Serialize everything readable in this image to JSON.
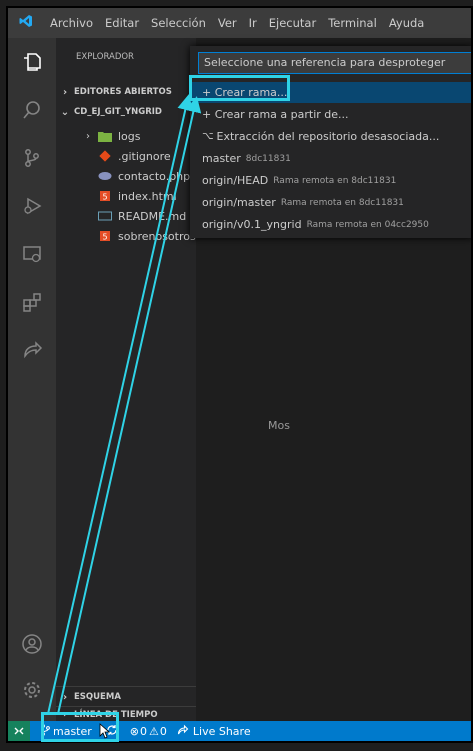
{
  "titlebar": {
    "menus": [
      "Archivo",
      "Editar",
      "Selección",
      "Ver",
      "Ir",
      "Ejecutar",
      "Terminal",
      "Ayuda"
    ]
  },
  "sidebar": {
    "title": "EXPLORADOR",
    "open_editors": "EDITORES ABIERTOS",
    "project": "CD_EJ_GIT_YNGRID",
    "files": [
      {
        "name": "logs",
        "icon": "folder-icon"
      },
      {
        "name": ".gitignore",
        "icon": "git-file-icon"
      },
      {
        "name": "contacto.php",
        "icon": "php-file-icon"
      },
      {
        "name": "index.html",
        "icon": "html-file-icon"
      },
      {
        "name": "README.md",
        "icon": "markdown-file-icon"
      },
      {
        "name": "sobrenosotros.html",
        "icon": "html-file-icon"
      }
    ],
    "outline": "ESQUEMA",
    "timeline": "LÍNEA DE TIEMPO"
  },
  "quickpick": {
    "placeholder": "Seleccione una referencia para desproteger",
    "items": [
      {
        "label": "+ Crear rama...",
        "desc": ""
      },
      {
        "label": "+ Crear rama a partir de...",
        "desc": ""
      },
      {
        "label": "Extracción del repositorio desasociada...",
        "desc": ""
      },
      {
        "label": "master",
        "desc": "8dc11831"
      },
      {
        "label": "origin/HEAD",
        "desc": "Rama remota en 8dc11831"
      },
      {
        "label": "origin/master",
        "desc": "Rama remota en 8dc11831"
      },
      {
        "label": "origin/v0.1_yngrid",
        "desc": "Rama remota en 04cc2950"
      }
    ]
  },
  "editor": {
    "partial_text": "Mos"
  },
  "statusbar": {
    "branch": "master",
    "errors": "0",
    "warnings": "0",
    "live_share": "Live Share"
  },
  "colors": {
    "accent": "#007acc",
    "highlight": "#2fd3e6",
    "selection": "#094771"
  }
}
